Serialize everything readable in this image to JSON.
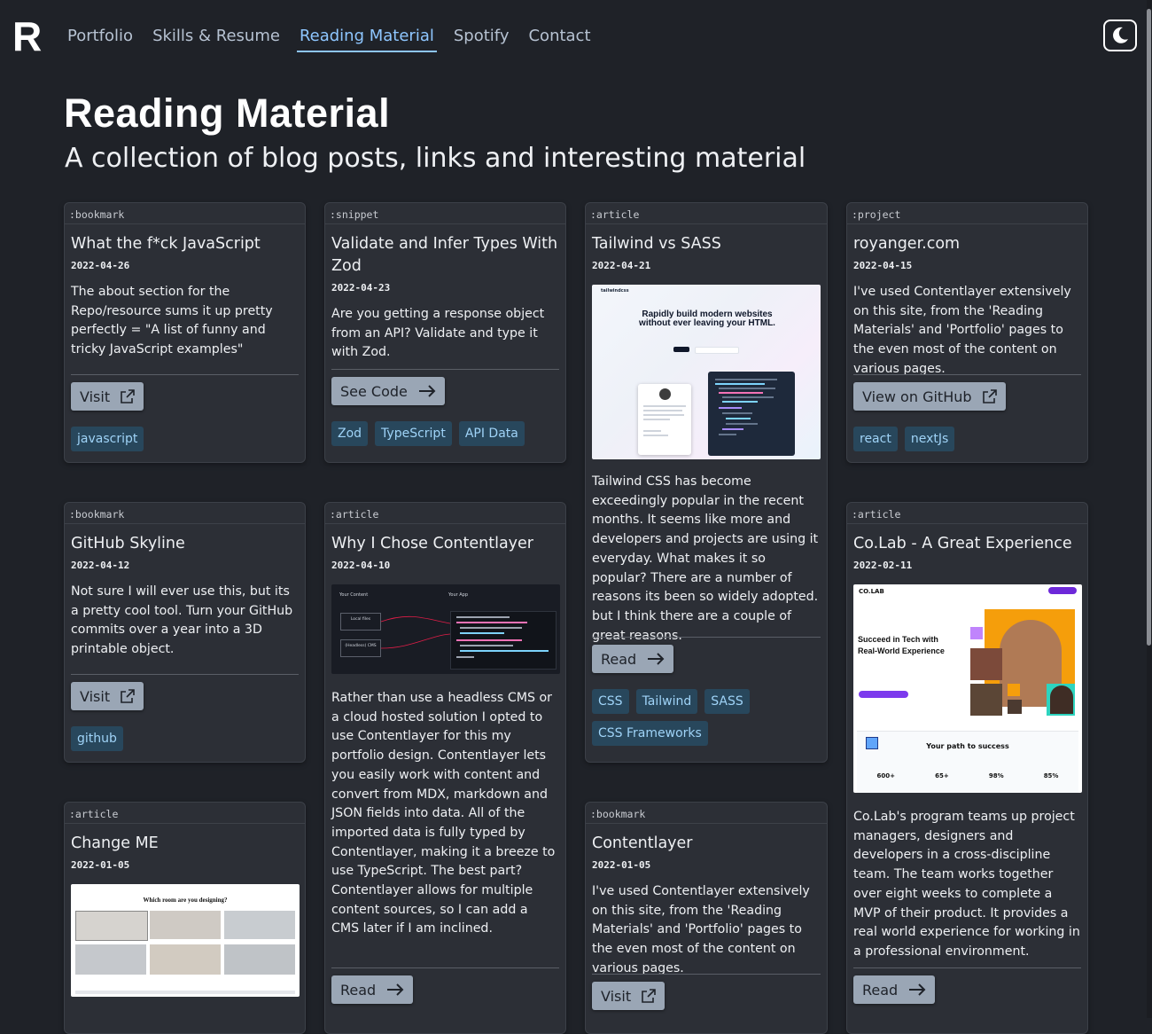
{
  "nav": {
    "logo": "R",
    "links": [
      "Portfolio",
      "Skills & Resume",
      "Reading Material",
      "Spotify",
      "Contact"
    ]
  },
  "header": {
    "title": "Reading Material",
    "subtitle": "A collection of blog posts, links and interesting material"
  },
  "cards": [
    {
      "type": ":bookmark",
      "title": "What the f*ck JavaScript",
      "date": "2022-04-26",
      "desc": "The about section for the Repo/resource sums it up pretty perfectly = \"A list of funny and tricky JavaScript examples\"",
      "button": "Visit",
      "tags": [
        "javascript"
      ]
    },
    {
      "type": ":snippet",
      "title": "Validate and Infer Types With Zod",
      "date": "2022-04-23",
      "desc": "Are you getting a response object from an API? Validate and type it with Zod.",
      "button": "See Code",
      "tags": [
        "Zod",
        "TypeScript",
        "API Data"
      ]
    },
    {
      "type": ":article",
      "title": "Tailwind vs SASS",
      "date": "2022-04-21",
      "desc": "Tailwind CSS has become exceedingly popular in the recent months. It seems like more and developers and projects are using it everyday. What makes it so popular? There are a number of reasons its been so widely adopted. but I think there are a couple of great reasons.",
      "button": "Read",
      "tags": [
        "CSS",
        "Tailwind",
        "SASS",
        "CSS Frameworks"
      ],
      "image": {
        "headline": "Rapidly build modern websites without ever leaving your HTML.",
        "brand": "tailwindcss"
      }
    },
    {
      "type": ":project",
      "title": "royanger.com",
      "date": "2022-04-15",
      "desc": "I've used Contentlayer extensively on this site, from the 'Reading Materials' and 'Portfolio' pages to the even most of the content on various pages.",
      "button": "View on GitHub",
      "tags": [
        "react",
        "nextJs"
      ]
    },
    {
      "type": ":bookmark",
      "title": "GitHub Skyline",
      "date": "2022-04-12",
      "desc": "Not sure I will ever use this, but its a pretty cool tool. Turn your GitHub commits over a year into a 3D printable object.",
      "button": "Visit",
      "tags": [
        "github"
      ]
    },
    {
      "type": ":article",
      "title": "Why I Chose Contentlayer",
      "date": "2022-04-10",
      "desc": "Rather than use a headless CMS or a cloud hosted solution I opted to use Contentlayer for this my portfolio design. Contentlayer lets you easily work with content and convert from MDX, markdown and JSON fields into data. All of the imported data is fully typed by Contentlayer, making it a breeze to use TypeScript. The best part? Contentlayer allows for multiple content sources, so I can add a CMS later if I am inclined.",
      "button": "Read",
      "image": {
        "left_label": "Your Content",
        "right_label": "Your App",
        "box1": "Local files",
        "box2": "(Headless) CMS"
      }
    },
    {
      "type": ":article",
      "title": "Co.Lab - A Great Experience",
      "date": "2022-02-11",
      "desc": "Co.Lab's program teams up project managers, designers and developers in a cross-discipline team. The team works together over eight weeks to complete a MVP of their product. It provides a real world experience for working in a professional environment.",
      "button": "Read",
      "image": {
        "brand": "CO.LAB",
        "headline": "Succeed in Tech with Real-World Experience",
        "section": "Your path to success",
        "stats": [
          "600+",
          "65+",
          "98%",
          "85%"
        ]
      }
    },
    {
      "type": ":article",
      "title": "Change ME",
      "date": "2022-01-05",
      "image": {
        "headline": "Which room are you designing?"
      }
    },
    {
      "type": ":bookmark",
      "title": "Contentlayer",
      "date": "2022-01-05",
      "desc": "I've used Contentlayer extensively on this site, from the 'Reading Materials' and 'Portfolio' pages to the even most of the content on various pages.",
      "button": "Visit"
    }
  ],
  "colors": {
    "background": "#1f2228",
    "card": "#2c2f36",
    "accent": "#8ec6ff",
    "tag_bg": "#28475c",
    "tag_text": "#9fd3f7",
    "button_bg": "#9aa6b5"
  },
  "icons": {
    "theme_toggle": "moon-icon",
    "external_link": "external-link-icon",
    "arrow": "arrow-right-icon"
  }
}
